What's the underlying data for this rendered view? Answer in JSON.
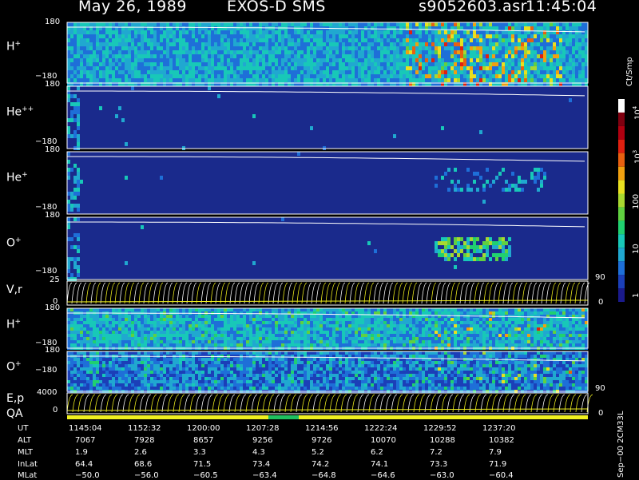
{
  "header": {
    "date": "May 26, 1989",
    "instrument": "EXOS-D SMS",
    "file": "s9052603.asr",
    "time": "11:45:04"
  },
  "colorbar": {
    "title": "Ct/Smp",
    "tick_labels": [
      "1",
      "10",
      "100",
      "10",
      "10"
    ],
    "exponents": [
      "",
      "",
      "",
      "3",
      "4"
    ],
    "colors": [
      "#1a1a8c",
      "#1b3fb8",
      "#1e6fd8",
      "#20a8d0",
      "#18c8b8",
      "#20d070",
      "#60d040",
      "#a8d830",
      "#e8e020",
      "#f0a010",
      "#e86010",
      "#e02010",
      "#b00010",
      "#800010",
      "#ffffff"
    ]
  },
  "panels": [
    {
      "name": "H+",
      "label": "H",
      "sup": "+",
      "ymax": "180",
      "ymin": "−180",
      "type": "spectrogram"
    },
    {
      "name": "He++",
      "label": "He",
      "sup": "++",
      "ymax": "180",
      "ymin": "−180",
      "type": "spectrogram"
    },
    {
      "name": "He+",
      "label": "He",
      "sup": "+",
      "ymax": "180",
      "ymin": "−180",
      "type": "spectrogram"
    },
    {
      "name": "O+",
      "label": "O",
      "sup": "+",
      "ymax": "180",
      "ymin": "−180",
      "type": "spectrogram"
    },
    {
      "name": "V,r",
      "label": "V,r",
      "sup": "",
      "ymax": "25",
      "ymin": "0",
      "right_top": "90",
      "right_bottom": "0",
      "type": "lines"
    },
    {
      "name": "H+ (2)",
      "label": "H",
      "sup": "+",
      "ymax": "180",
      "ymin": "−180",
      "type": "spectrogram"
    },
    {
      "name": "O+ (2)",
      "label": "O",
      "sup": "+",
      "ymax": "180",
      "ymin": "−180",
      "type": "spectrogram"
    },
    {
      "name": "E,p",
      "label": "E,p",
      "sup": "",
      "ymax": "4000",
      "ymin": "0",
      "right_top": "90",
      "right_bottom": "0",
      "type": "lines"
    }
  ],
  "qa": {
    "label": "QA",
    "bar_color": "#f0f020",
    "mark_color": "#20c060"
  },
  "footer_table": {
    "row_labels": [
      "UT",
      "ALT",
      "MLT",
      "InLat",
      "MLat"
    ],
    "columns": [
      [
        "1145:04",
        "7067",
        "1.9",
        "64.4",
        "−50.0"
      ],
      [
        "1152:32",
        "7928",
        "2.6",
        "68.6",
        "−56.0"
      ],
      [
        "1200:00",
        "8657",
        "3.3",
        "71.5",
        "−60.5"
      ],
      [
        "1207:28",
        "9256",
        "4.3",
        "73.4",
        "−63.4"
      ],
      [
        "1214:56",
        "9726",
        "5.2",
        "74.2",
        "−64.8"
      ],
      [
        "1222:24",
        "10070",
        "6.2",
        "74.1",
        "−64.6"
      ],
      [
        "1229:52",
        "10288",
        "7.2",
        "73.3",
        "−63.0"
      ],
      [
        "1237:20",
        "10382",
        "7.9",
        "71.9",
        "−60.4"
      ]
    ]
  },
  "side_note": "Sep−00  2CM33L",
  "chart_data": {
    "type": "heatmap",
    "title": "May 26, 1989   EXOS-D SMS",
    "x_ticks": [
      "1145:04",
      "1152:32",
      "1200:00",
      "1207:28",
      "1214:56",
      "1222:24",
      "1229:52",
      "1237:20"
    ],
    "series": [
      {
        "name": "H+",
        "ylim": [
          -180,
          180
        ]
      },
      {
        "name": "He++",
        "ylim": [
          -180,
          180
        ]
      },
      {
        "name": "He+",
        "ylim": [
          -180,
          180
        ]
      },
      {
        "name": "O+",
        "ylim": [
          -180,
          180
        ]
      },
      {
        "name": "V,r",
        "ylim": [
          0,
          25
        ]
      },
      {
        "name": "H+",
        "ylim": [
          -180,
          180
        ]
      },
      {
        "name": "O+",
        "ylim": [
          -180,
          180
        ]
      },
      {
        "name": "E,p",
        "ylim": [
          0,
          4000
        ]
      }
    ],
    "colorbar_label": "Ct/Smp",
    "colorbar_scale": "log"
  }
}
